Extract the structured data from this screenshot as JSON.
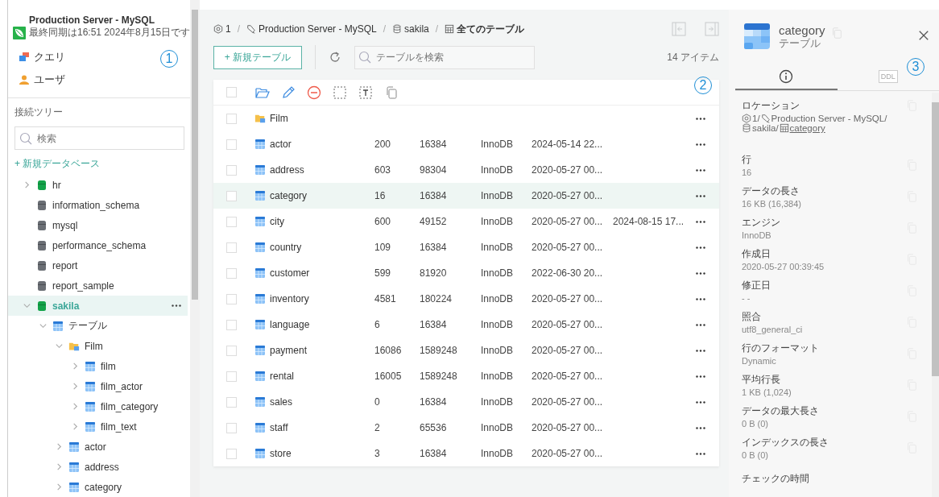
{
  "connection": {
    "title": "Production Server - MySQL",
    "subtitle": "最終同期は16:51 2024年8月15日です"
  },
  "nav": [
    {
      "kind": "query",
      "label": "クエリ"
    },
    {
      "kind": "user",
      "label": "ユーザ"
    }
  ],
  "tree_label": "接続ツリー",
  "tree_search": {
    "placeholder": "検索"
  },
  "new_database": "+ 新規データベース",
  "tree": [
    {
      "kind": "database",
      "connected": true,
      "label": "hr",
      "expanded": false,
      "selected": false
    },
    {
      "kind": "database",
      "connected": false,
      "label": "information_schema",
      "selected": false
    },
    {
      "kind": "database",
      "connected": false,
      "label": "mysql",
      "selected": false
    },
    {
      "kind": "database",
      "connected": false,
      "label": "performance_schema",
      "selected": false
    },
    {
      "kind": "database",
      "connected": false,
      "label": "report",
      "selected": false
    },
    {
      "kind": "database",
      "connected": false,
      "label": "report_sample",
      "selected": false
    },
    {
      "kind": "database",
      "connected": true,
      "label": "sakila",
      "expanded": true,
      "selected": true,
      "children": [
        {
          "kind": "table",
          "label": "テーブル",
          "expanded": true,
          "selected": false,
          "children": [
            {
              "kind": "folder",
              "label": "Film",
              "expanded": true,
              "selected": false,
              "children": [
                {
                  "kind": "table",
                  "label": "film",
                  "expanded": false,
                  "selected": false
                },
                {
                  "kind": "table",
                  "label": "film_actor",
                  "expanded": false,
                  "selected": false
                },
                {
                  "kind": "table",
                  "label": "film_category",
                  "expanded": false,
                  "selected": false
                },
                {
                  "kind": "table",
                  "label": "film_text",
                  "expanded": false,
                  "selected": false
                }
              ]
            },
            {
              "kind": "table",
              "label": "actor",
              "expanded": false,
              "selected": false
            },
            {
              "kind": "table",
              "label": "address",
              "expanded": false,
              "selected": false
            },
            {
              "kind": "table",
              "label": "category",
              "expanded": false,
              "selected": false
            }
          ]
        }
      ]
    }
  ],
  "breadcrumb": {
    "separator": "/",
    "items": [
      {
        "kind": "instance",
        "label": "1"
      },
      {
        "kind": "connection",
        "label": "Production Server - MySQL"
      },
      {
        "kind": "database",
        "label": "sakila"
      },
      {
        "kind": "tables",
        "label": "全てのテーブル"
      }
    ]
  },
  "new_table_button": "+ 新規テーブル",
  "table_search": {
    "placeholder": "テーブルを検索"
  },
  "item_count": "14 アイテム",
  "header_checkbox": {
    "checked": false
  },
  "rows": [
    {
      "kind": "folder",
      "name": "Film",
      "checked": false,
      "selected": false
    },
    {
      "kind": "table",
      "name": "actor",
      "checked": false,
      "selected": false,
      "column_3": "200",
      "column_4": "16384",
      "column_5": "InnoDB",
      "column_6": "2024-05-14 22..."
    },
    {
      "kind": "table",
      "name": "address",
      "checked": false,
      "selected": false,
      "column_3": "603",
      "column_4": "98304",
      "column_5": "InnoDB",
      "column_6": "2020-05-27 00..."
    },
    {
      "kind": "table",
      "name": "category",
      "checked": false,
      "selected": true,
      "column_3": "16",
      "column_4": "16384",
      "column_5": "InnoDB",
      "column_6": "2020-05-27 00..."
    },
    {
      "kind": "table",
      "name": "city",
      "checked": false,
      "selected": false,
      "column_3": "600",
      "column_4": "49152",
      "column_5": "InnoDB",
      "column_6": "2020-05-27 00...",
      "column_7": "2024-08-15 17..."
    },
    {
      "kind": "table",
      "name": "country",
      "checked": false,
      "selected": false,
      "column_3": "109",
      "column_4": "16384",
      "column_5": "InnoDB",
      "column_6": "2020-05-27 00..."
    },
    {
      "kind": "table",
      "name": "customer",
      "checked": false,
      "selected": false,
      "column_3": "599",
      "column_4": "81920",
      "column_5": "InnoDB",
      "column_6": "2022-06-30 20..."
    },
    {
      "kind": "table",
      "name": "inventory",
      "checked": false,
      "selected": false,
      "column_3": "4581",
      "column_4": "180224",
      "column_5": "InnoDB",
      "column_6": "2020-05-27 00..."
    },
    {
      "kind": "table",
      "name": "language",
      "checked": false,
      "selected": false,
      "column_3": "6",
      "column_4": "16384",
      "column_5": "InnoDB",
      "column_6": "2020-05-27 00..."
    },
    {
      "kind": "table",
      "name": "payment",
      "checked": false,
      "selected": false,
      "column_3": "16086",
      "column_4": "1589248",
      "column_5": "InnoDB",
      "column_6": "2020-05-27 00..."
    },
    {
      "kind": "table",
      "name": "rental",
      "checked": false,
      "selected": false,
      "column_3": "16005",
      "column_4": "1589248",
      "column_5": "InnoDB",
      "column_6": "2020-05-27 00..."
    },
    {
      "kind": "table",
      "name": "sales",
      "checked": false,
      "selected": false,
      "column_3": "0",
      "column_4": "16384",
      "column_5": "InnoDB",
      "column_6": "2020-05-27 00..."
    },
    {
      "kind": "table",
      "name": "staff",
      "checked": false,
      "selected": false,
      "column_3": "2",
      "column_4": "65536",
      "column_5": "InnoDB",
      "column_6": "2020-05-27 00..."
    },
    {
      "kind": "table",
      "name": "store",
      "checked": false,
      "selected": false,
      "column_3": "3",
      "column_4": "16384",
      "column_5": "InnoDB",
      "column_6": "2020-05-27 00..."
    }
  ],
  "details": {
    "title": "category",
    "subtitle": "テーブル",
    "tabs": [
      {
        "kind": "info",
        "selected": true
      },
      {
        "kind": "ddl",
        "label": "DDL",
        "selected": false
      }
    ],
    "location": {
      "label": "ロケーション",
      "segments": [
        {
          "kind": "instance",
          "text": "1/"
        },
        {
          "kind": "connection",
          "text": "Production Server - MySQL/"
        },
        {
          "kind": "database",
          "text": "sakila/"
        },
        {
          "kind": "table",
          "text": "category",
          "link": true
        }
      ]
    },
    "properties": [
      {
        "label": "行",
        "value": "16"
      },
      {
        "label": "データの長さ",
        "value": "16 KB (16,384)"
      },
      {
        "label": "エンジン",
        "value": "InnoDB"
      },
      {
        "label": "作成日",
        "value": "2020-05-27 00:39:45"
      },
      {
        "label": "修正日",
        "value": "- -"
      },
      {
        "label": "照合",
        "value": "utf8_general_ci"
      },
      {
        "label": "行のフォーマット",
        "value": "Dynamic"
      },
      {
        "label": "平均行長",
        "value": "1 KB (1,024)"
      },
      {
        "label": "データの最大長さ",
        "value": "0 B (0)"
      },
      {
        "label": "インデックスの長さ",
        "value": "0 B (0)"
      },
      {
        "label": "チェックの時間"
      }
    ]
  },
  "sidebar_callout": "1",
  "table_callout": "2",
  "details_callout": "3"
}
